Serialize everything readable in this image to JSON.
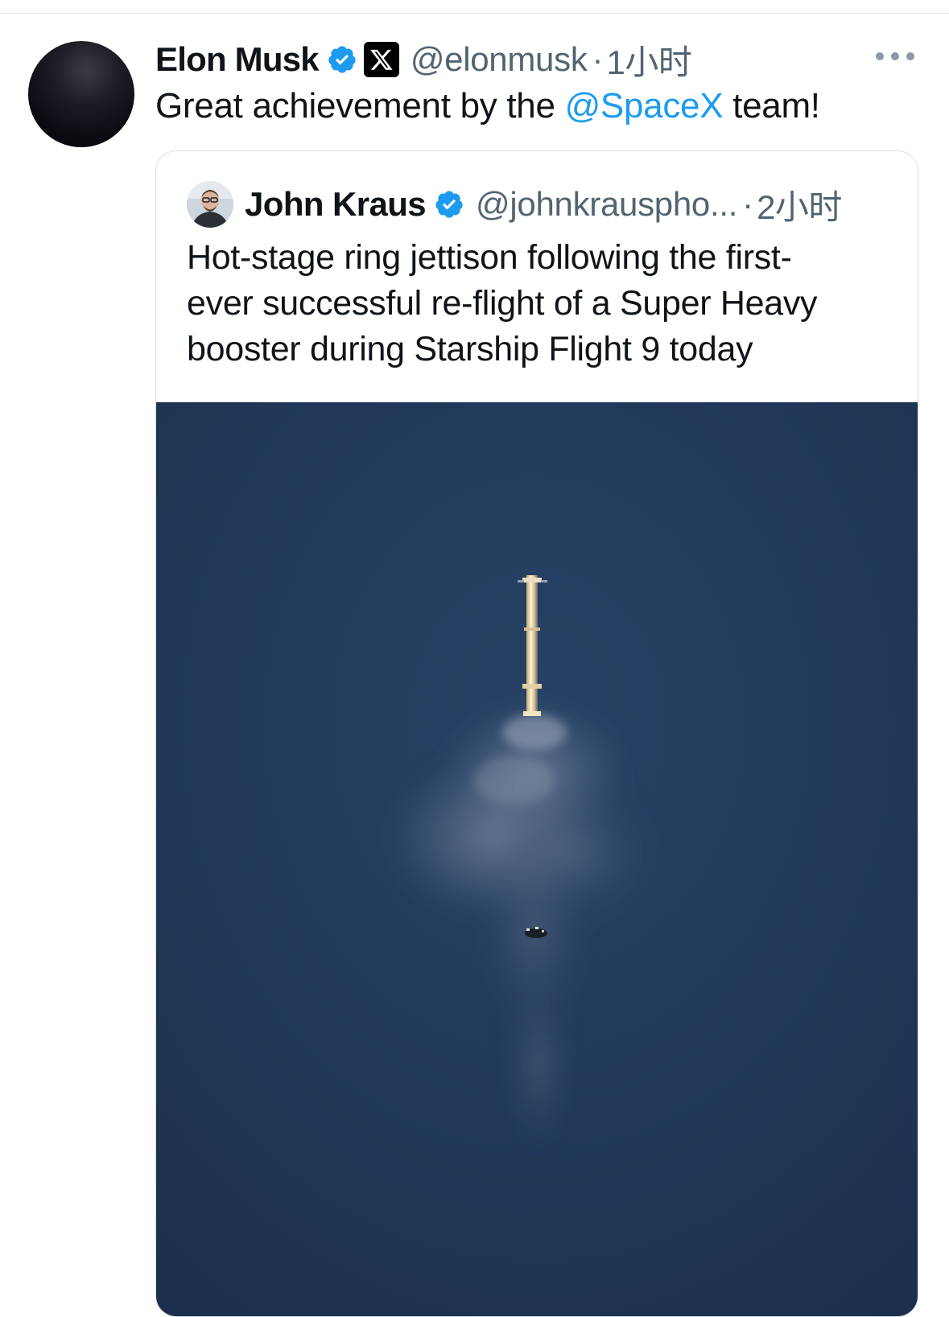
{
  "tweet": {
    "author_name": "Elon Musk",
    "handle": "@elonmusk",
    "separator": "·",
    "time": "1小时",
    "verified_icon": "verified-badge-icon",
    "affiliation_icon": "x-logo-icon",
    "text_before": "Great achievement by the ",
    "mention": "@SpaceX",
    "text_after": " team!",
    "more_icon": "more-options-icon"
  },
  "quote": {
    "author_name": "John Kraus",
    "handle": "@johnkrauspho...",
    "separator": "·",
    "time": "2小时",
    "text": "Hot-stage ring jettison following the first-ever successful re-flight of a Super Heavy booster during Starship Flight 9 today",
    "text_lines": [
      "Hot-stage ring jettison following the first-",
      "ever successful re-flight of a Super Heavy",
      "booster during Starship Flight 9 today"
    ]
  },
  "colors": {
    "link": "#1d9bf0",
    "verified": "#1d9bf0",
    "secondary_text": "#536471",
    "sky": "#1f3554"
  }
}
